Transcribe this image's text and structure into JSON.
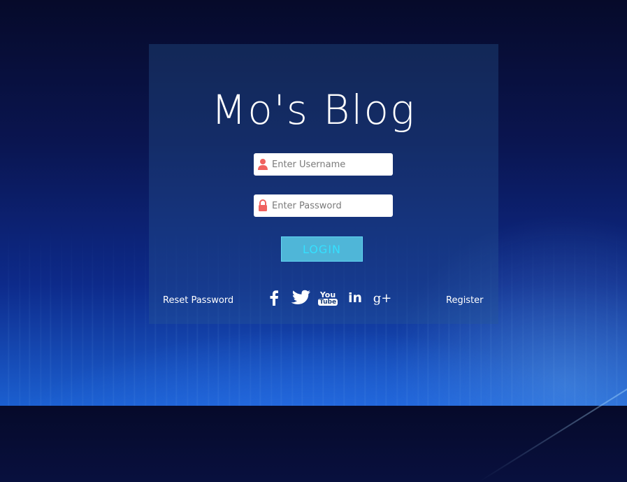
{
  "brand": {
    "title": "Mo's Blog"
  },
  "form": {
    "username_placeholder": "Enter Username",
    "password_placeholder": "Enter Password",
    "login_label": "LOGIN"
  },
  "footer": {
    "reset_label": "Reset Password",
    "register_label": "Register",
    "social": [
      {
        "name": "facebook-icon"
      },
      {
        "name": "twitter-icon"
      },
      {
        "name": "youtube-icon",
        "label_top": "You",
        "label_bottom": "Tube"
      },
      {
        "name": "linkedin-icon",
        "label": "in"
      },
      {
        "name": "google-plus-icon",
        "label": "g+"
      }
    ]
  },
  "colors": {
    "icon_accent": "#f0625f",
    "button_bg": "#4fb6d8",
    "button_text": "#35e0ff",
    "card_bg": "rgba(40,90,150,0.35)"
  }
}
